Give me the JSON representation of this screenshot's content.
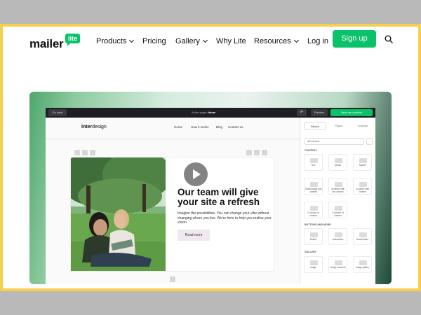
{
  "nav": {
    "logo_text": "mailer",
    "logo_badge": "lite",
    "items": [
      {
        "label": "Products",
        "dropdown": true
      },
      {
        "label": "Pricing",
        "dropdown": false
      },
      {
        "label": "Gallery",
        "dropdown": true
      },
      {
        "label": "Why Lite",
        "dropdown": false
      },
      {
        "label": "Resources",
        "dropdown": true
      }
    ],
    "login": "Log in",
    "signup": "Sign up",
    "search_icon": "search-icon"
  },
  "colors": {
    "brand_green": "#09c269",
    "frame_border": "#f7cf4a"
  },
  "editor": {
    "back": "Go back",
    "active_page_label": "Active page:",
    "active_page": "Home",
    "preview": "Preview",
    "save": "Save and publish",
    "undo_icon": "undo-icon"
  },
  "site": {
    "logo_bold": "Inter",
    "logo_rest": "design",
    "menu": [
      "Home",
      "How it works",
      "Blog",
      "Contact us"
    ],
    "headline": "Our team will give your site a refresh",
    "body": "Imagine the possibilities. You can change your vibe without changing where you live. We're here to help you realise your vision.",
    "cta": "Read more"
  },
  "panel": {
    "tabs": [
      "Blocks",
      "Pages",
      "Settings"
    ],
    "filter": "All blocks",
    "sections": [
      {
        "title": "CONTENT",
        "blocks": [
          "Text",
          "Media",
          "Spacer",
          "Small image and content",
          "Centered with two column",
          "2 column with content",
          "2 column of content",
          "3 column of content"
        ]
      },
      {
        "title": "BUTTONS AND MORE",
        "blocks": [
          "Button",
          "Subscribes",
          "Social share"
        ]
      },
      {
        "title": "GALLERY",
        "blocks": [
          "Image",
          "Image carousel",
          "Image gallery"
        ]
      }
    ]
  }
}
